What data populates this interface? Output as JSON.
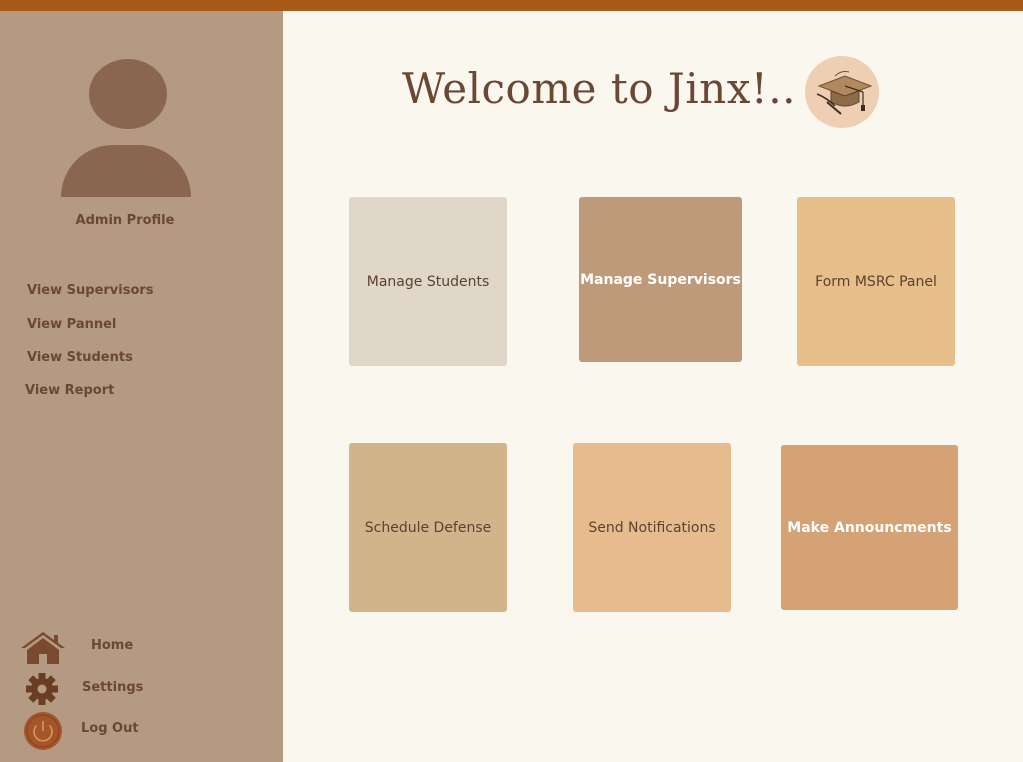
{
  "sidebar": {
    "profile_label": "Admin Profile",
    "nav": [
      {
        "label": "View Supervisors"
      },
      {
        "label": "View Pannel"
      },
      {
        "label": "View Students"
      },
      {
        "label": "View Report"
      }
    ],
    "bottom": {
      "home": "Home",
      "settings": "Settings",
      "logout": "Log Out"
    }
  },
  "main": {
    "welcome": "Welcome to Jinx!..",
    "tiles": [
      {
        "label": "Manage Students",
        "color": "#e0d7c8"
      },
      {
        "label": "Manage Supervisors",
        "color": "#bf9a7a"
      },
      {
        "label": "Form MSRC Panel",
        "color": "#e6bf8a"
      },
      {
        "label": "Schedule Defense",
        "color": "#d2b48a"
      },
      {
        "label": "Send Notifications",
        "color": "#e8bb8e"
      },
      {
        "label": "Make Announcments",
        "color": "#d4a275"
      }
    ]
  },
  "colors": {
    "topbar": "#a85a18",
    "sidebar": "#b59a83",
    "text_brown": "#6b4735",
    "background": "#faf7ef"
  },
  "icons": [
    "user-avatar-icon",
    "home-icon",
    "gear-icon",
    "power-icon",
    "graduation-cap-icon"
  ]
}
